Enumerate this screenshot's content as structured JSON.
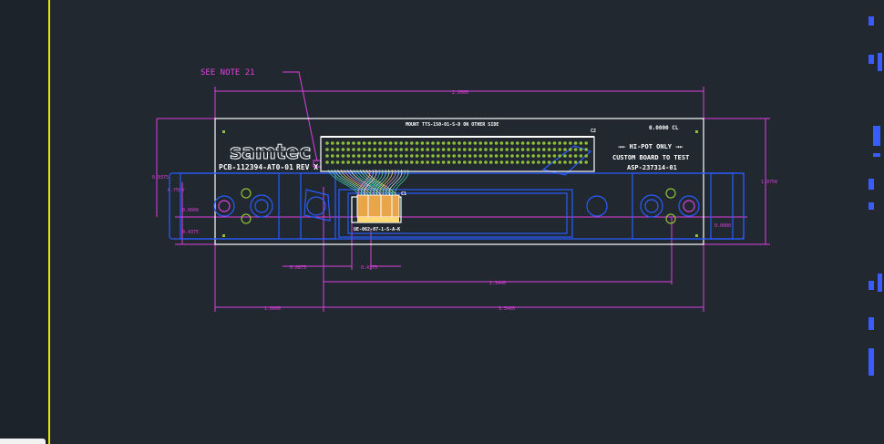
{
  "drawing": {
    "callout_note": "SEE NOTE 21",
    "logo_text": "samtec",
    "part_label": "PCB-112394-AT0-01",
    "rev_label": "REV X",
    "mount_note": "MOUNT TTS-150-01-S-D ON OTHER SIDE",
    "c2_label": "C2",
    "c1_label": "C1",
    "centerline_label": "0.0000 CL",
    "hipot_label": "→← HI-POT ONLY →←",
    "custom_label": "CUSTOM BOARD TO TEST",
    "asp_label": "ASP-237314-01",
    "connector_label": "UE-062-07-1-S-A-K",
    "dims": {
      "overall_top": "2.9500",
      "right_height": "1.0750",
      "left_small": "0.9375",
      "left_a": "0.7500",
      "left_b": "0.0000",
      "left_c": "0.4375",
      "right_small": "0.0000",
      "bottom_a": "0.0875",
      "bottom_b": "0.4375",
      "bottom_mid": "2.3440",
      "bottom_left": "1.0000",
      "bottom_right": "3.5400"
    },
    "colors": {
      "background": "#212830",
      "outline": "#ffffff",
      "dimension": "#e040e0",
      "hardware": "#2a5cff",
      "pads": "#8fbf3a",
      "guide": "#e6e600"
    }
  }
}
